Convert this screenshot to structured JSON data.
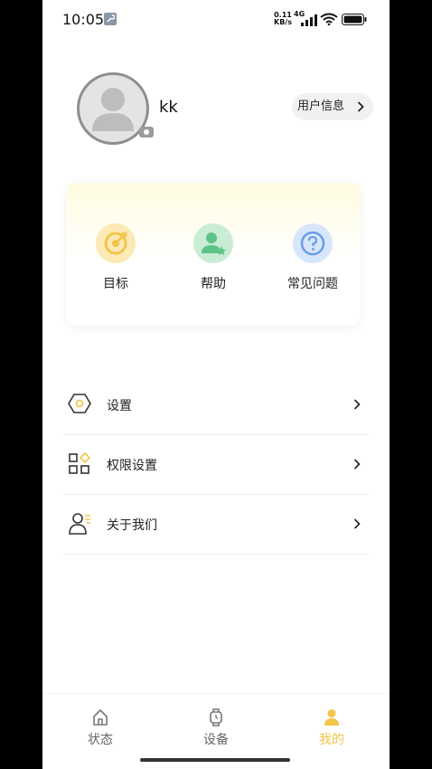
{
  "status_bar": {
    "time": "10:05",
    "net_speed_value": "0.11",
    "net_speed_unit": "KB/s",
    "network_type": "4G",
    "icons": [
      "wrench-icon",
      "signal-icon",
      "wifi-icon",
      "battery-icon"
    ]
  },
  "profile": {
    "username": "kk",
    "user_info_label": "用户信息"
  },
  "quick_actions": [
    {
      "label": "目标",
      "icon": "target-icon",
      "color": "#f2c54b"
    },
    {
      "label": "帮助",
      "icon": "help-person-icon",
      "color": "#5cc487"
    },
    {
      "label": "常见问题",
      "icon": "question-icon",
      "color": "#6a9ce8"
    }
  ],
  "menu": [
    {
      "label": "设置",
      "icon": "settings-hex-icon"
    },
    {
      "label": "权限设置",
      "icon": "permissions-grid-icon"
    },
    {
      "label": "关于我们",
      "icon": "about-person-icon"
    }
  ],
  "tabs": [
    {
      "label": "状态",
      "icon": "home-icon",
      "active": false
    },
    {
      "label": "设备",
      "icon": "watch-icon",
      "active": false
    },
    {
      "label": "我的",
      "icon": "person-icon",
      "active": true
    }
  ],
  "colors": {
    "accent": "#f2c54b",
    "tab_inactive": "#666666"
  }
}
